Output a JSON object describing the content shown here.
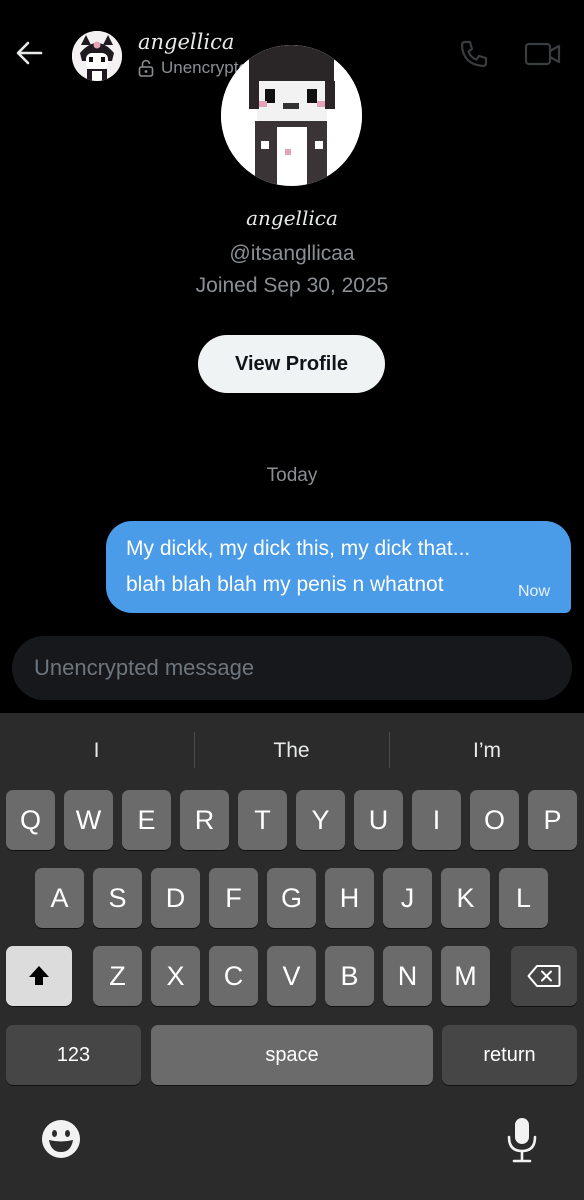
{
  "header": {
    "name": "angellica",
    "status": "Unencrypted"
  },
  "profile": {
    "name": "angellica",
    "handle": "@itsangllicaa",
    "joined": "Joined Sep 30, 2025",
    "view_profile_label": "View Profile"
  },
  "conversation": {
    "date_separator": "Today",
    "messages": [
      {
        "line1": "My dickk, my dick this, my dick that...",
        "line2": "blah blah blah my penis n whatnot",
        "time": "Now",
        "outgoing": true
      }
    ]
  },
  "composer": {
    "placeholder": "Unencrypted message"
  },
  "keyboard": {
    "suggestions": [
      "I",
      "The",
      "I’m"
    ],
    "row1": [
      "Q",
      "W",
      "E",
      "R",
      "T",
      "Y",
      "U",
      "I",
      "O",
      "P"
    ],
    "row2": [
      "A",
      "S",
      "D",
      "F",
      "G",
      "H",
      "J",
      "K",
      "L"
    ],
    "row3": [
      "Z",
      "X",
      "C",
      "V",
      "B",
      "N",
      "M"
    ],
    "numbers_label": "123",
    "space_label": "space",
    "return_label": "return"
  },
  "colors": {
    "background": "#000000",
    "bubble": "#4a9be8",
    "secondary_text": "#8b8f94",
    "keyboard_bg": "#2b2b2b",
    "key_bg": "#6b6b6b",
    "func_key_bg": "#464646"
  },
  "icons": {
    "back": "arrow-left-icon",
    "lock": "unlocked-lock-icon",
    "call": "phone-icon",
    "video": "video-camera-icon",
    "shift": "shift-arrow-icon",
    "delete": "backspace-icon",
    "emoji": "emoji-icon",
    "mic": "microphone-icon"
  }
}
